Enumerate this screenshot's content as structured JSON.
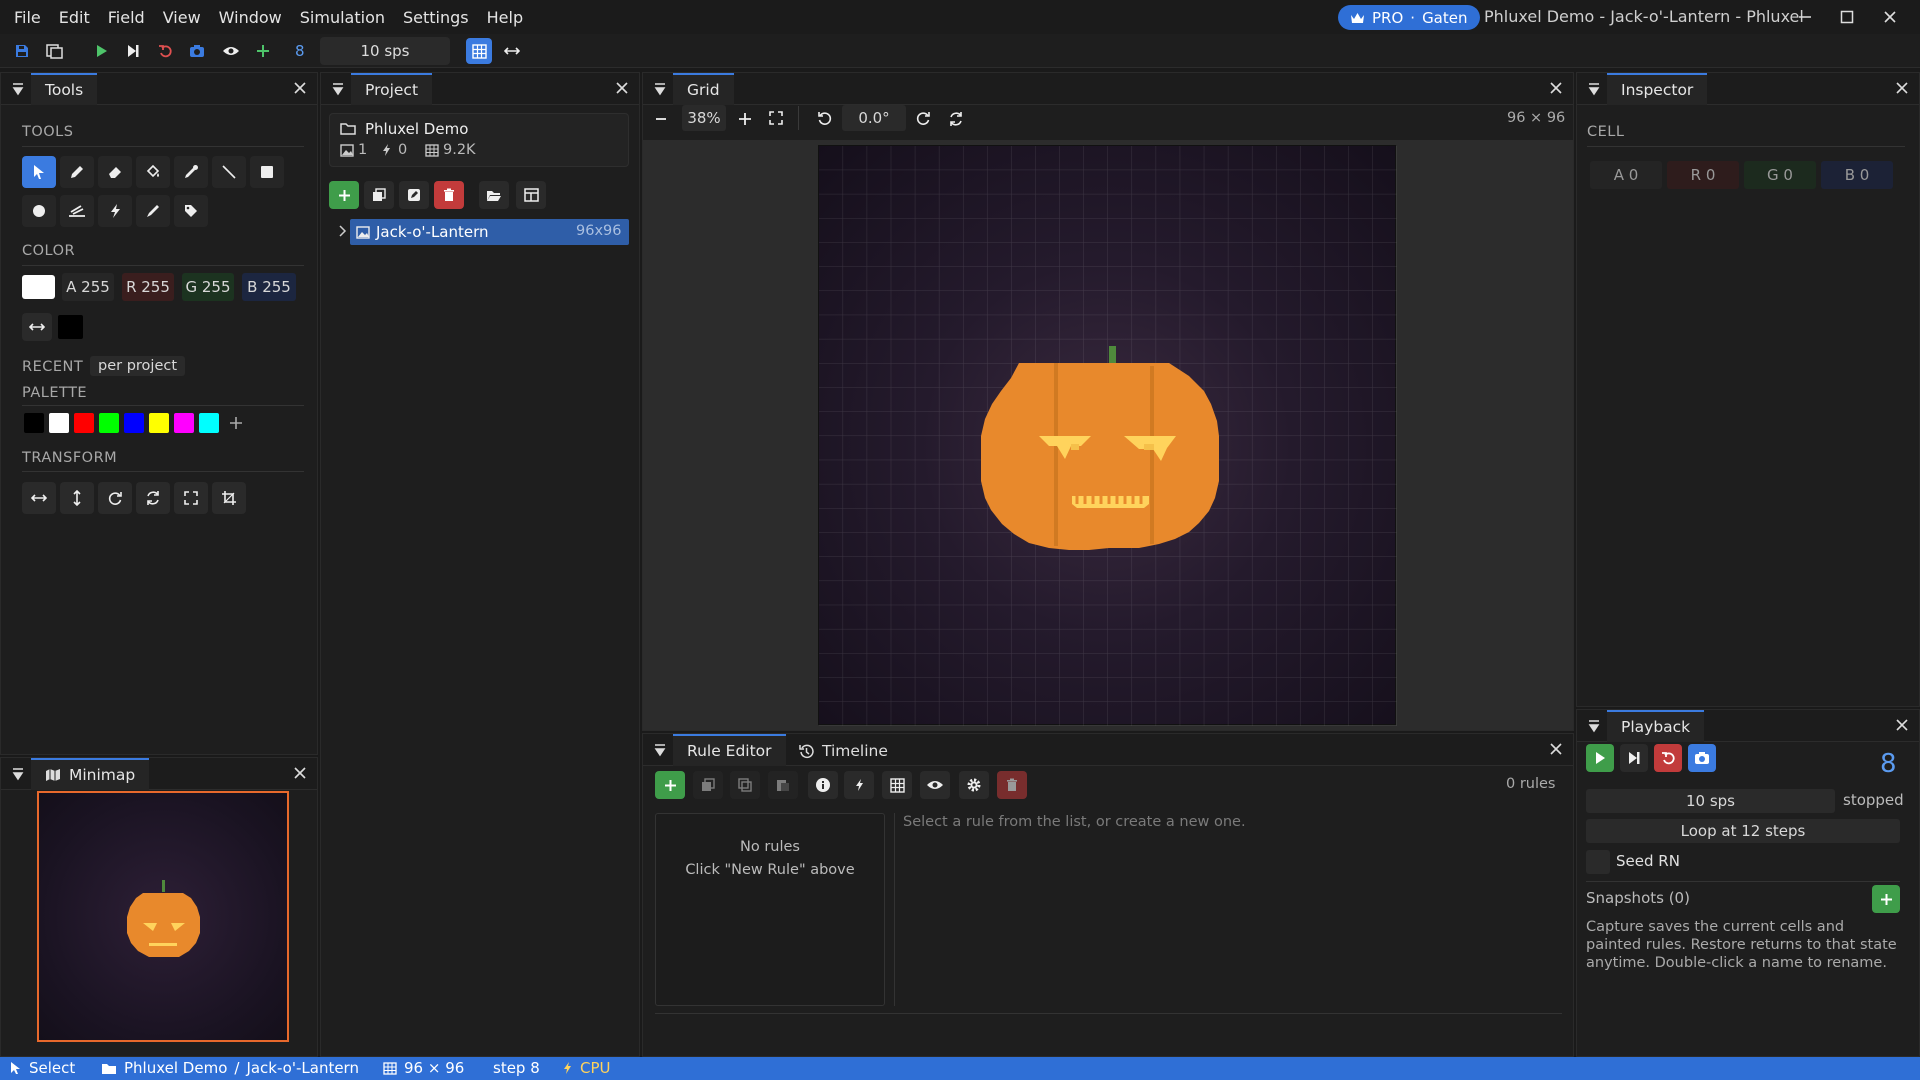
{
  "menu": [
    "File",
    "Edit",
    "Field",
    "View",
    "Window",
    "Simulation",
    "Settings",
    "Help"
  ],
  "pro_badge": {
    "label": "PRO",
    "user": "Gaten"
  },
  "window_title": "Phluxel Demo - Jack-o'-Lantern - Phluxel",
  "toolbar": {
    "step_count": "8",
    "sps": "10 sps"
  },
  "tools_panel": {
    "title": "Tools",
    "tools_label": "TOOLS",
    "color_label": "COLOR",
    "color": {
      "a": "A 255",
      "r": "R 255",
      "g": "G 255",
      "b": "B 255"
    },
    "recent_label": "RECENT",
    "recent_scope": "per project",
    "palette_label": "PALETTE",
    "palette": [
      "#000000",
      "#ffffff",
      "#ff0000",
      "#00ff00",
      "#0000ff",
      "#ffff00",
      "#ff00ff",
      "#00ffff"
    ],
    "transform_label": "TRANSFORM"
  },
  "minimap_panel": {
    "title": "Minimap"
  },
  "project_panel": {
    "title": "Project",
    "project_name": "Phluxel Demo",
    "stats": {
      "images": "1",
      "rules": "0",
      "cells": "9.2K"
    },
    "item": {
      "name": "Jack-o'-Lantern",
      "size": "96x96"
    }
  },
  "grid_panel": {
    "title": "Grid",
    "zoom": "38%",
    "rotation": "0.0°",
    "dims": "96 × 96"
  },
  "inspector_panel": {
    "title": "Inspector",
    "cell_label": "CELL",
    "cell": {
      "a": "A 0",
      "r": "R 0",
      "g": "G 0",
      "b": "B 0"
    }
  },
  "rule_editor": {
    "tab_rules": "Rule Editor",
    "tab_timeline": "Timeline",
    "rules_count": "0 rules",
    "empty_title": "No rules",
    "empty_hint": "Click \"New Rule\" above",
    "detail_hint": "Select a rule from the list, or create a new one."
  },
  "playback": {
    "title": "Playback",
    "step": "8",
    "sps": "10 sps",
    "state": "stopped",
    "loop": "Loop at 12 steps",
    "seed": "Seed RN",
    "snapshots": "Snapshots (0)",
    "help": "Capture saves the current cells and painted rules. Restore returns to that state anytime. Double-click a name to rename."
  },
  "statusbar": {
    "tool": "Select",
    "project": "Phluxel Demo",
    "image": "Jack-o'-Lantern",
    "dims": "96 × 96",
    "step": "step 8",
    "backend": "CPU"
  },
  "colors": {
    "accent": "#3b7be0",
    "pumpkin": "#e8892c",
    "stem": "#4f8a3c",
    "eyes": "#ffd35c"
  }
}
